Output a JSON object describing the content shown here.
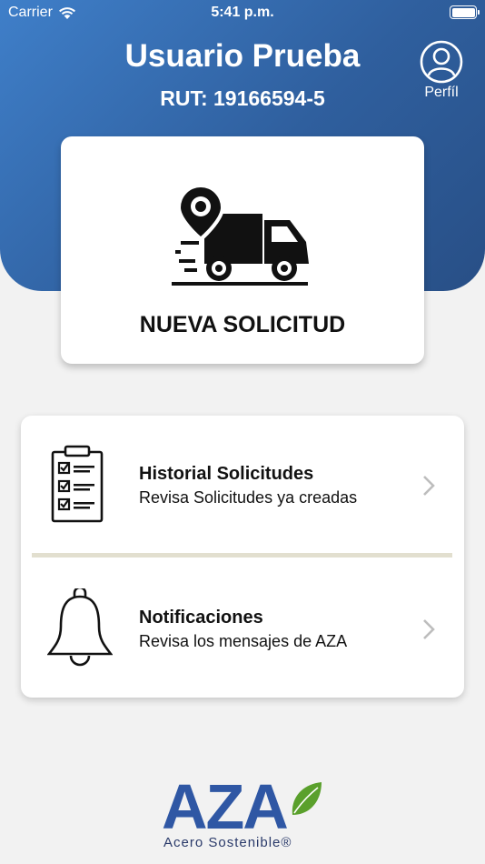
{
  "status_bar": {
    "carrier": "Carrier",
    "time": "5:41 p.m."
  },
  "header": {
    "user_name": "Usuario Prueba",
    "rut": "RUT: 19166594-5",
    "profile_label": "Perfíl"
  },
  "new_request": {
    "label": "NUEVA SOLICITUD"
  },
  "menu": [
    {
      "title": "Historial Solicitudes",
      "subtitle": "Revisa Solicitudes ya creadas",
      "icon": "clipboard-checklist-icon"
    },
    {
      "title": "Notificaciones",
      "subtitle": "Revisa los mensajes de AZA",
      "icon": "bell-icon"
    }
  ],
  "brand": {
    "name": "AZA",
    "tagline": "Acero Sostenible®"
  },
  "colors": {
    "header_start": "#3f7fc9",
    "header_end": "#284f86",
    "background": "#f2f2f2",
    "brand_blue": "#2f57a4",
    "leaf_green": "#5aa02c",
    "divider": "#e2dfcf"
  }
}
